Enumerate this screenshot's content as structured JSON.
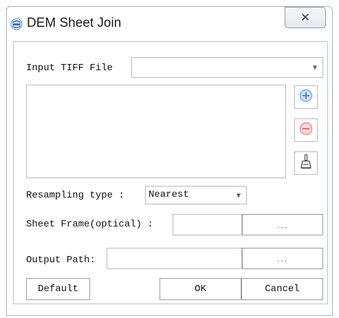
{
  "window": {
    "title": "DEM Sheet Join",
    "close_glyph": "✕"
  },
  "icons": {
    "app": "app-logo-icon",
    "add": "plus-circle-icon",
    "remove": "minus-circle-icon",
    "clear": "broom-icon"
  },
  "form": {
    "input_tiff_label": "Input TIFF File",
    "input_tiff_value": "",
    "resampling_label": "Resampling type :",
    "resampling_value": "Nearest",
    "sheet_frame_label": "Sheet Frame(optical) :",
    "sheet_frame_value": "",
    "sheet_frame_browse": "...",
    "output_path_label": "Output Path:",
    "output_path_value": "",
    "output_browse": "..."
  },
  "buttons": {
    "default": "Default",
    "ok": "OK",
    "cancel": "Cancel"
  },
  "colors": {
    "add_blue": "#7aa7e6",
    "remove_red": "#ef8a8a",
    "border": "#b9b9b9"
  }
}
